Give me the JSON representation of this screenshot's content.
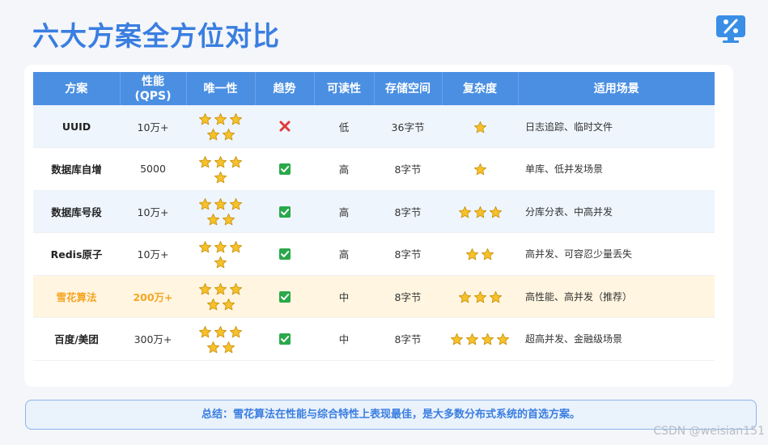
{
  "title": "六大方案全方位对比",
  "logo_icon": "percent-screen-icon",
  "colors": {
    "accent": "#3a7ee0",
    "header": "#4a8fe2",
    "highlight": "#f5a623",
    "star": "#f6c12a",
    "check": "#2aa84a",
    "cross": "#e03a3a"
  },
  "table": {
    "headers": [
      "方案",
      "性能",
      "(QPS)",
      "唯一性",
      "趋势",
      "可读性",
      "存储空间",
      "复杂度",
      "适用场景"
    ],
    "rows": [
      {
        "name": "UUID",
        "perf": "10万+",
        "unique_stars": 5,
        "trend": "cross",
        "readability": "低",
        "storage": "36字节",
        "complexity": 1,
        "scene": "日志追踪、临时文件"
      },
      {
        "name": "数据库自增",
        "perf": "5000",
        "unique_stars": 4,
        "trend": "check",
        "readability": "高",
        "storage": "8字节",
        "complexity": 1,
        "scene": "单库、低并发场景"
      },
      {
        "name": "数据库号段",
        "perf": "10万+",
        "unique_stars": 5,
        "trend": "check",
        "readability": "高",
        "storage": "8字节",
        "complexity": 3,
        "scene": "分库分表、中高并发"
      },
      {
        "name": "Redis原子",
        "perf": "10万+",
        "unique_stars": 4,
        "trend": "check",
        "readability": "高",
        "storage": "8字节",
        "complexity": 2,
        "scene": "高并发、可容忍少量丢失"
      },
      {
        "name": "雪花算法",
        "perf": "200万+",
        "unique_stars": 5,
        "trend": "check",
        "readability": "中",
        "storage": "8字节",
        "complexity": 3,
        "scene": "高性能、高并发（推荐）",
        "highlight": true
      },
      {
        "name": "百度/美团",
        "perf": "300万+",
        "unique_stars": 5,
        "trend": "check",
        "readability": "中",
        "storage": "8字节",
        "complexity": 4,
        "scene": "超高并发、金融级场景"
      }
    ]
  },
  "summary": "总结：雪花算法在性能与综合特性上表现最佳，是大多数分布式系统的首选方案。",
  "watermark": "CSDN @weisian151"
}
